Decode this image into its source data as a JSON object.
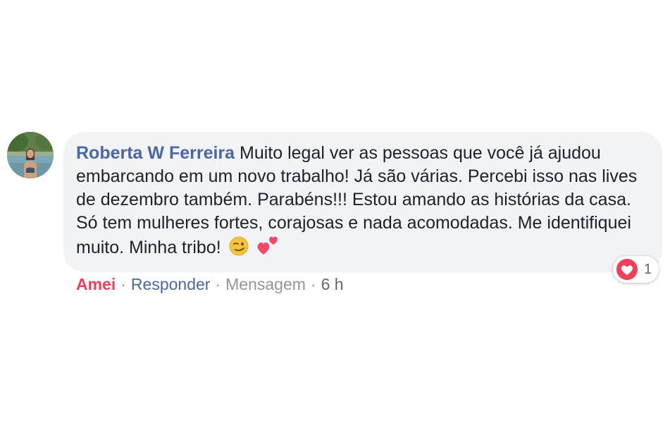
{
  "comment": {
    "author": "Roberta W Ferreira",
    "text": "Muito legal ver as pessoas que você já ajudou embarcando em um novo trabalho! Já são várias. Percebi isso nas lives de dezembro também. Parabéns!!! Estou amando as histórias da casa. Só tem mulheres fortes, corajosas e nada acomodadas. Me identifiquei muito. Minha tribo!",
    "emojis": [
      "winking-face-emoji",
      "two-hearts-emoji"
    ]
  },
  "reaction": {
    "icon": "love-reaction-icon",
    "count": "1",
    "color": "#f33e58"
  },
  "actions": {
    "love_label": "Amei",
    "reply_label": "Responder",
    "message_label": "Mensagem",
    "separator": "·",
    "time": "6 h"
  },
  "colors": {
    "author": "#4b67a1",
    "bubble": "#f2f3f5",
    "love": "#f33e58"
  }
}
